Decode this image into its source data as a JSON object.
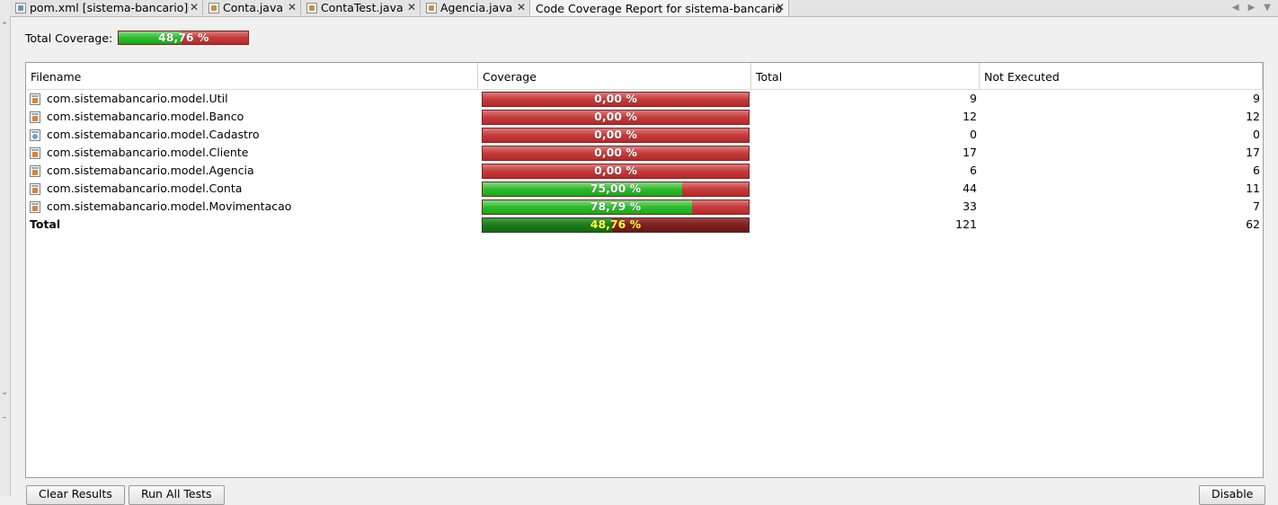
{
  "tabs": [
    {
      "label": "pom.xml [sistema-bancario]",
      "icon": "maven-xml-icon",
      "active": false
    },
    {
      "label": "Conta.java",
      "icon": "java-file-icon",
      "active": false
    },
    {
      "label": "ContaTest.java",
      "icon": "java-file-icon",
      "active": false
    },
    {
      "label": "Agencia.java",
      "icon": "java-file-icon",
      "active": false
    },
    {
      "label": "Code Coverage Report for sistema-bancario",
      "icon": "",
      "active": true
    }
  ],
  "tab_close_glyph": "✕",
  "summary": {
    "label": "Total Coverage:",
    "value_text": "48,76 %",
    "fraction": 0.4876
  },
  "table": {
    "headers": [
      "Filename",
      "Coverage",
      "Total",
      "Not Executed"
    ],
    "rows": [
      {
        "filename": "com.sistemabancario.model.Util",
        "coverage_text": "0,00 %",
        "fraction": 0.0,
        "total": "9",
        "not_executed": "9",
        "icon": "java-class-icon"
      },
      {
        "filename": "com.sistemabancario.model.Banco",
        "coverage_text": "0,00 %",
        "fraction": 0.0,
        "total": "12",
        "not_executed": "12",
        "icon": "java-class-icon"
      },
      {
        "filename": "com.sistemabancario.model.Cadastro",
        "coverage_text": "0,00 %",
        "fraction": 0.0,
        "total": "0",
        "not_executed": "0",
        "icon": "java-interface-icon"
      },
      {
        "filename": "com.sistemabancario.model.Cliente",
        "coverage_text": "0,00 %",
        "fraction": 0.0,
        "total": "17",
        "not_executed": "17",
        "icon": "java-class-icon"
      },
      {
        "filename": "com.sistemabancario.model.Agencia",
        "coverage_text": "0,00 %",
        "fraction": 0.0,
        "total": "6",
        "not_executed": "6",
        "icon": "java-class-icon"
      },
      {
        "filename": "com.sistemabancario.model.Conta",
        "coverage_text": "75,00 %",
        "fraction": 0.75,
        "total": "44",
        "not_executed": "11",
        "icon": "java-class-icon"
      },
      {
        "filename": "com.sistemabancario.model.Movimentacao",
        "coverage_text": "78,79 %",
        "fraction": 0.7879,
        "total": "33",
        "not_executed": "7",
        "icon": "java-class-icon"
      }
    ],
    "total_row": {
      "filename": "Total",
      "coverage_text": "48,76 %",
      "fraction": 0.4876,
      "total": "121",
      "not_executed": "62"
    }
  },
  "buttons": {
    "clear": "Clear Results",
    "run_all": "Run All Tests",
    "disable": "Disable"
  },
  "colors": {
    "covered": "#2dbb2d",
    "uncovered": "#c63a3a",
    "total_text": "#ffff33"
  }
}
